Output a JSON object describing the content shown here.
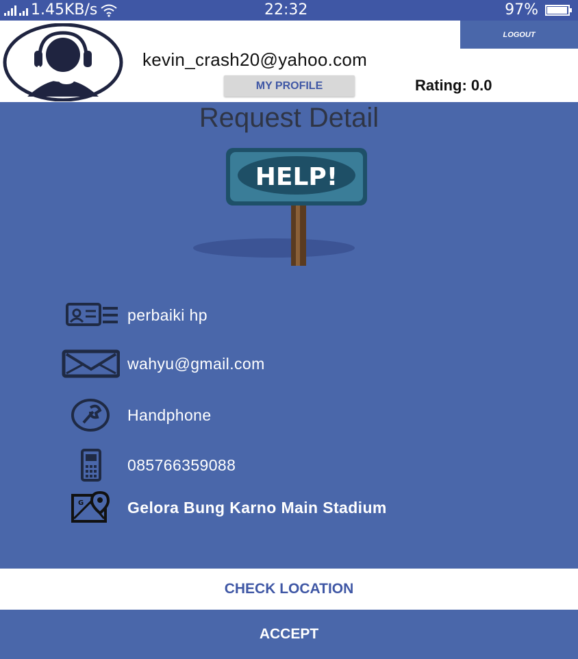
{
  "status_bar": {
    "signal_text": "1.45KB/s",
    "time": "22:32",
    "battery": "97%",
    "battery_level": 0.97
  },
  "header": {
    "email": "kevin_crash20@yahoo.com",
    "logout_label": "LOGOUT",
    "my_profile_label": "MY PROFILE",
    "rating": "Rating: 0.0"
  },
  "page": {
    "title": "Request Detail",
    "help_sign_text": "HELP!"
  },
  "details": {
    "name": {
      "icon": "id-card-icon",
      "value": "perbaiki hp"
    },
    "email": {
      "icon": "envelope-icon",
      "value": "wahyu@gmail.com"
    },
    "category": {
      "icon": "wrench-icon",
      "value": "Handphone"
    },
    "phone": {
      "icon": "phone-icon",
      "value": "085766359088"
    },
    "location": {
      "icon": "map-icon",
      "value": "Gelora Bung Karno Main Stadium"
    }
  },
  "actions": {
    "check_location_label": "CHECK LOCATION",
    "accept_label": "ACCEPT"
  },
  "colors": {
    "primary": "#4a67aa",
    "status_bar": "#3f57a5",
    "header_bg": "#ffffff",
    "button_text": "#3f57a5"
  }
}
